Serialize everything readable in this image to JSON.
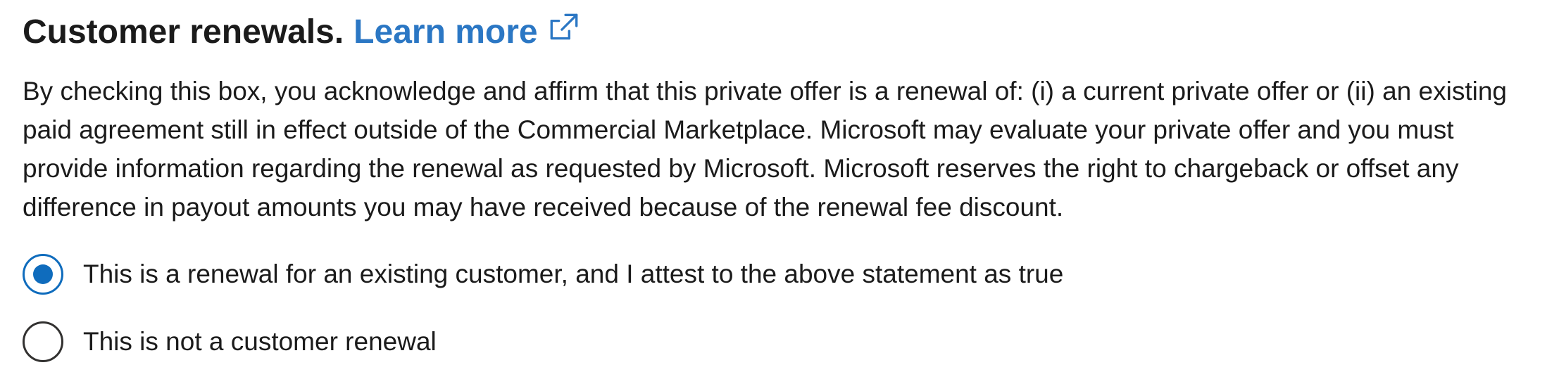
{
  "section": {
    "title": "Customer renewals.",
    "learn_more_label": "Learn more",
    "learn_more_icon": "external-link-icon",
    "description": "By checking this box, you acknowledge and affirm that this private offer is a renewal of: (i) a current private offer or (ii) an existing paid agreement still in effect outside of the Commercial Marketplace. Microsoft may evaluate your private offer and you must provide information regarding the renewal as requested by Microsoft. Microsoft reserves the right to chargeback or offset any difference in payout amounts you may have received because of the renewal fee discount.",
    "options": [
      {
        "label": "This is a renewal for an existing customer, and I attest to the above statement as true",
        "selected": true
      },
      {
        "label": "This is not a customer renewal",
        "selected": false
      }
    ]
  },
  "colors": {
    "link": "#2b77c4",
    "radio_selected": "#0f6cbd",
    "text": "#1b1b1b"
  }
}
